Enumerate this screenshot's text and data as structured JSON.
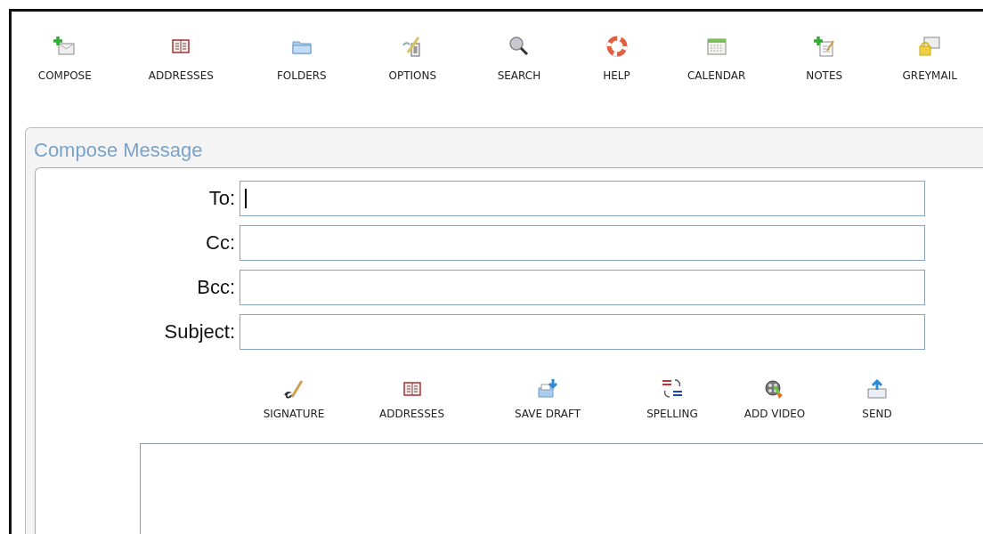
{
  "toolbar": [
    {
      "kind": "compose",
      "label": "COMPOSE"
    },
    {
      "kind": "addresses",
      "label": "ADDRESSES"
    },
    {
      "kind": "folders",
      "label": "FOLDERS"
    },
    {
      "kind": "options",
      "label": "OPTIONS"
    },
    {
      "kind": "search",
      "label": "SEARCH"
    },
    {
      "kind": "help",
      "label": "HELP"
    },
    {
      "kind": "calendar",
      "label": "CALENDAR"
    },
    {
      "kind": "notes",
      "label": "NOTES"
    },
    {
      "kind": "greymail",
      "label": "GREYMAIL"
    }
  ],
  "compose": {
    "title": "Compose Message",
    "fields": [
      {
        "label": "To:",
        "focused": true
      },
      {
        "label": "Cc:",
        "focused": false
      },
      {
        "label": "Bcc:",
        "focused": false
      },
      {
        "label": "Subject:",
        "focused": false
      }
    ],
    "actions": [
      {
        "kind": "signature",
        "label": "SIGNATURE"
      },
      {
        "kind": "addresses",
        "label": "ADDRESSES"
      },
      {
        "kind": "save",
        "label": "SAVE DRAFT"
      },
      {
        "kind": "spelling",
        "label": "SPELLING"
      },
      {
        "kind": "video",
        "label": "ADD VIDEO"
      },
      {
        "kind": "send",
        "label": "SEND"
      }
    ]
  }
}
